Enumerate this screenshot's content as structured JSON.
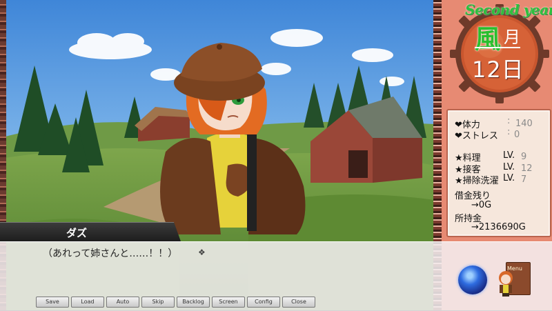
{
  "calendar": {
    "year_label": "Second year",
    "season_kanji": "風",
    "month_label": "月",
    "day_label": "12日"
  },
  "stats": {
    "stamina_label": "❤体力",
    "stamina_value": "140",
    "stress_label": "❤ストレス",
    "stress_value": "0",
    "cooking_label": "★料理",
    "cooking_lv_label": "LV.",
    "cooking_value": "9",
    "service_label": "★接客",
    "service_lv_label": "LV.",
    "service_value": "12",
    "cleaning_label": "★掃除洗濯",
    "cleaning_lv_label": "LV.",
    "cleaning_value": "7",
    "debt_label": "借金残り",
    "debt_value": "→0G",
    "money_label": "所持金",
    "money_value": "→2136690G",
    "separator": ":"
  },
  "dialogue": {
    "speaker": "ダズ",
    "text": "（あれって姉さんと……！！）"
  },
  "menu": {
    "save": "Save",
    "load": "Load",
    "auto": "Auto",
    "skip": "Skip",
    "backlog": "Backlog",
    "screen": "Screen",
    "config": "Config",
    "close": "Close",
    "book_label": "Menu"
  }
}
